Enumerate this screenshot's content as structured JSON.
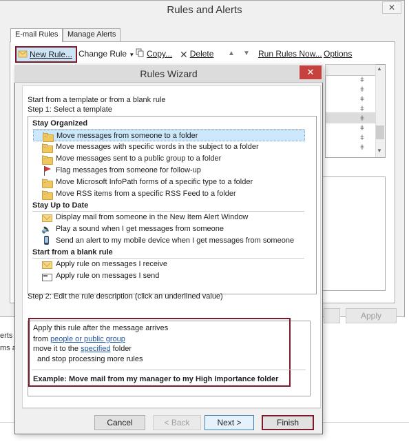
{
  "outer_window": {
    "title": "Rules and Alerts",
    "close_label": "✕",
    "tabs": [
      "E-mail Rules",
      "Manage Alerts"
    ],
    "toolbar": {
      "new_rule": "New Rule...",
      "change_rule": "Change Rule",
      "copy": "Copy...",
      "delete": "Delete",
      "run_rules_now": "Run Rules Now...",
      "options": "Options"
    },
    "apply_label": "Apply",
    "partial_text": [
      "erts t",
      "ms a"
    ]
  },
  "wizard": {
    "title": "Rules Wizard",
    "close_label": "✕",
    "intro": "Start from a template or from a blank rule",
    "step1": "Step 1: Select a template",
    "groups": [
      {
        "heading": "Stay Organized",
        "items": [
          {
            "label": "Move messages from someone to a folder",
            "icon": "move-folder-icon",
            "selected": true
          },
          {
            "label": "Move messages with specific words in the subject to a folder",
            "icon": "move-folder-icon"
          },
          {
            "label": "Move messages sent to a public group to a folder",
            "icon": "move-folder-icon"
          },
          {
            "label": "Flag messages from someone for follow-up",
            "icon": "flag-icon"
          },
          {
            "label": "Move Microsoft InfoPath forms of a specific type to a folder",
            "icon": "move-folder-icon"
          },
          {
            "label": "Move RSS items from a specific RSS Feed to a folder",
            "icon": "move-folder-icon"
          }
        ]
      },
      {
        "heading": "Stay Up to Date",
        "items": [
          {
            "label": "Display mail from someone in the New Item Alert Window",
            "icon": "envelope-alert-icon"
          },
          {
            "label": "Play a sound when I get messages from someone",
            "icon": "speaker-icon"
          },
          {
            "label": "Send an alert to my mobile device when I get messages from someone",
            "icon": "mobile-phone-icon"
          }
        ]
      },
      {
        "heading": "Start from a blank rule",
        "items": [
          {
            "label": "Apply rule on messages I receive",
            "icon": "envelope-icon"
          },
          {
            "label": "Apply rule on messages I send",
            "icon": "outbox-icon"
          }
        ]
      }
    ],
    "step2": "Step 2: Edit the rule description (click an underlined value)",
    "description": {
      "line1": "Apply this rule after the message arrives",
      "line2_prefix": "from ",
      "line2_link": "people or public group",
      "line3_prefix": "move it to the ",
      "line3_link": "specified",
      "line3_suffix": " folder",
      "line4": "and stop processing more rules",
      "example": "Example: Move mail from my manager to my High Importance folder"
    },
    "buttons": {
      "cancel": "Cancel",
      "back": "< Back",
      "next": "Next >",
      "finish": "Finish"
    }
  },
  "colors": {
    "highlight_border": "#7a1a2a",
    "selection": "#cde8fb",
    "close_red": "#c7423f",
    "link": "#2457a6"
  }
}
